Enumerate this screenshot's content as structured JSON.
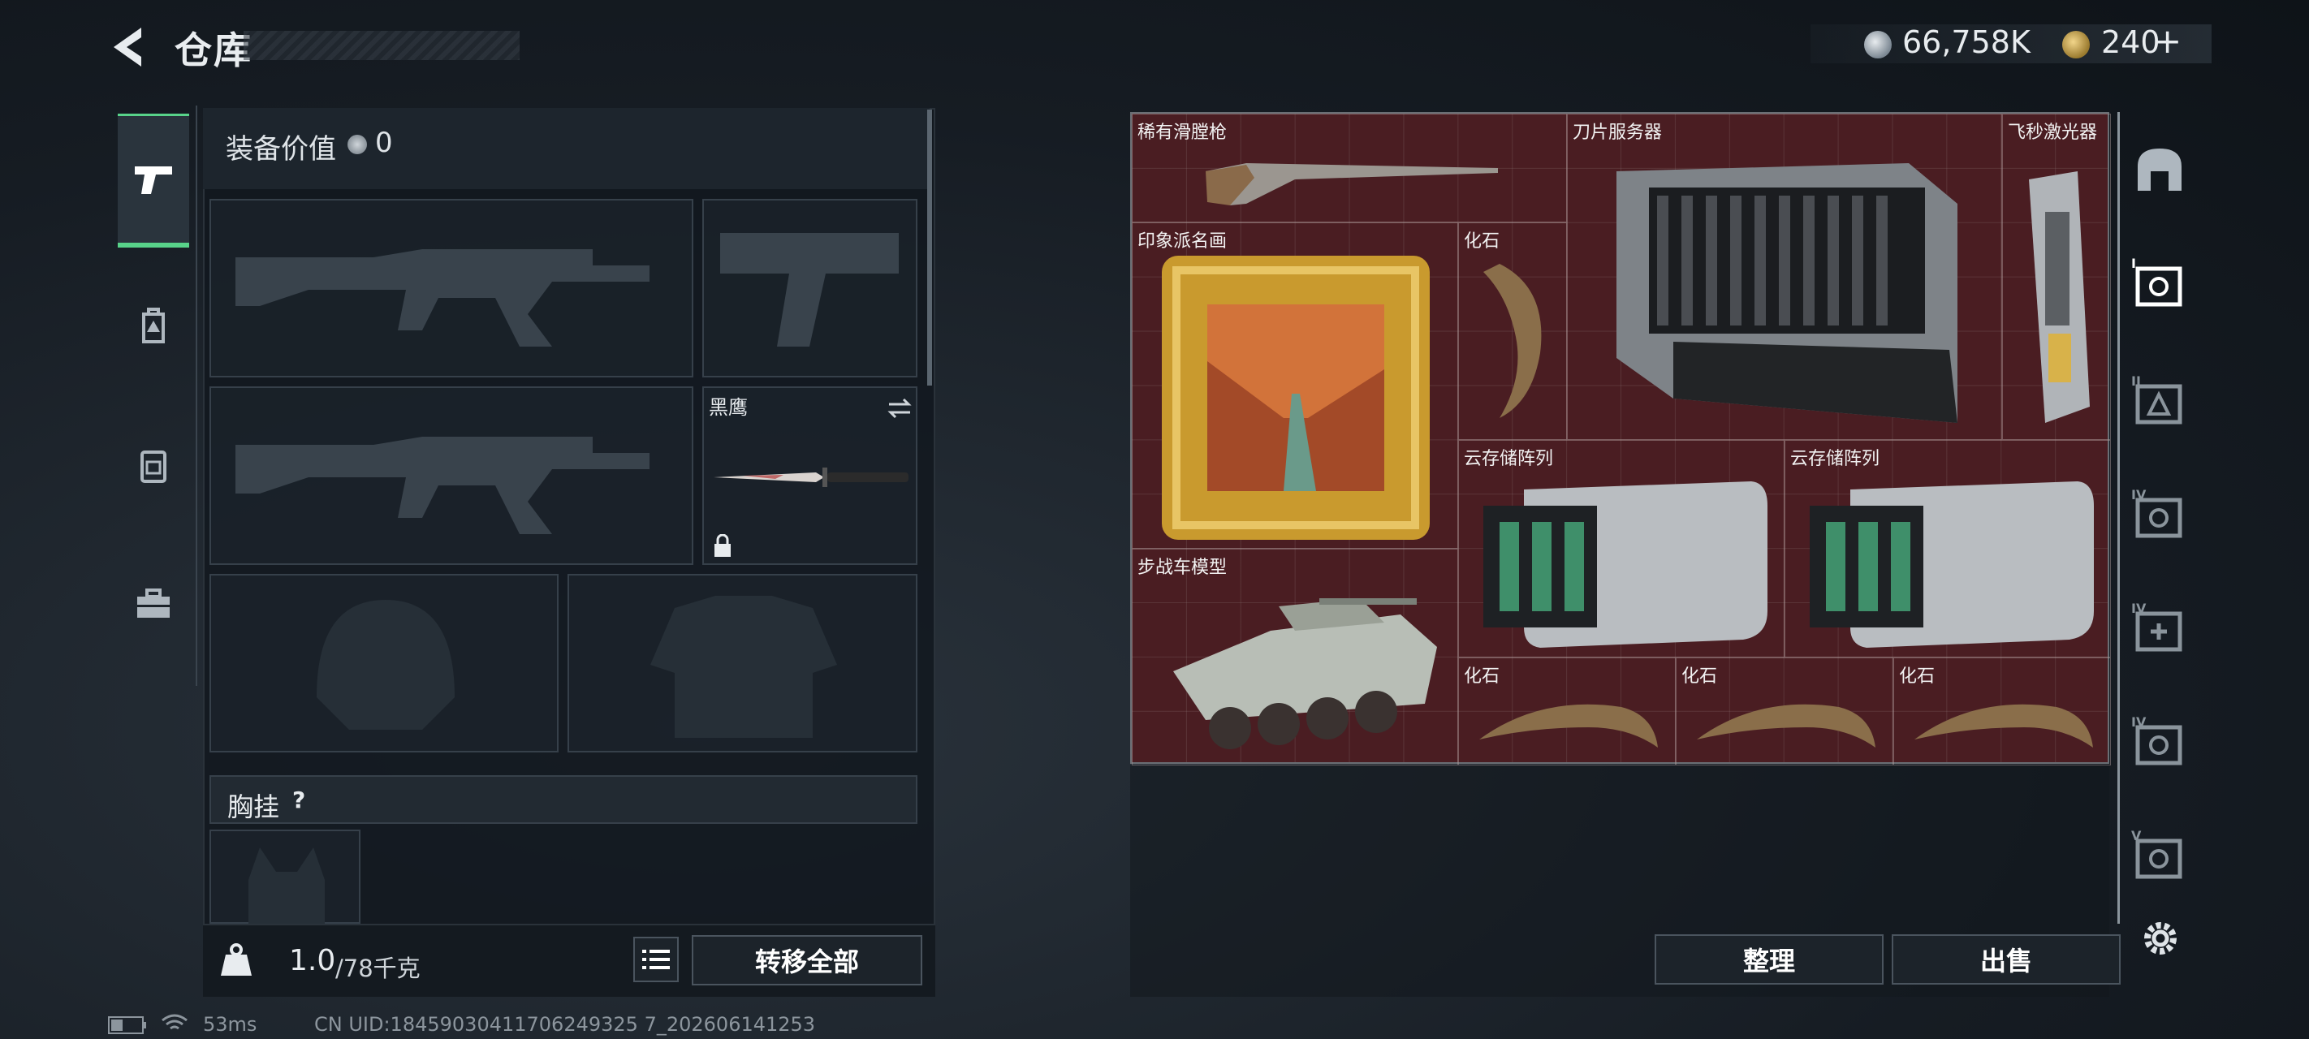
{
  "header": {
    "title": "仓库",
    "currency_silver": "66,758K",
    "currency_gold": "240"
  },
  "left_tabs": [
    {
      "name": "weapons"
    },
    {
      "name": "backpack-armor"
    },
    {
      "name": "backpack"
    },
    {
      "name": "toolbox"
    }
  ],
  "equipment": {
    "value_label": "装备价值",
    "value": "0",
    "knife_slot_label": "黑鹰",
    "vest_label": "胸挂",
    "vest_help": "?",
    "weight": "1.0",
    "weight_max": "/78千克",
    "transfer_all_label": "转移全部"
  },
  "warehouse": {
    "items": [
      {
        "label": "稀有滑膛枪"
      },
      {
        "label": "刀片服务器"
      },
      {
        "label": "飞秒激光器"
      },
      {
        "label": "印象派名画"
      },
      {
        "label": "化石"
      },
      {
        "label": "云存储阵列"
      },
      {
        "label": "云存储阵列"
      },
      {
        "label": "步战车模型"
      },
      {
        "label": "化石"
      },
      {
        "label": "化石"
      },
      {
        "label": "化石"
      }
    ],
    "sort_label": "整理",
    "sell_label": "出售"
  },
  "right_tabs": [
    "I",
    "II",
    "III",
    "IV",
    "IV",
    "IV",
    "V"
  ],
  "status": {
    "ping": "53ms",
    "uid": "CN UID:18459030411706249325 7_202606141253"
  }
}
